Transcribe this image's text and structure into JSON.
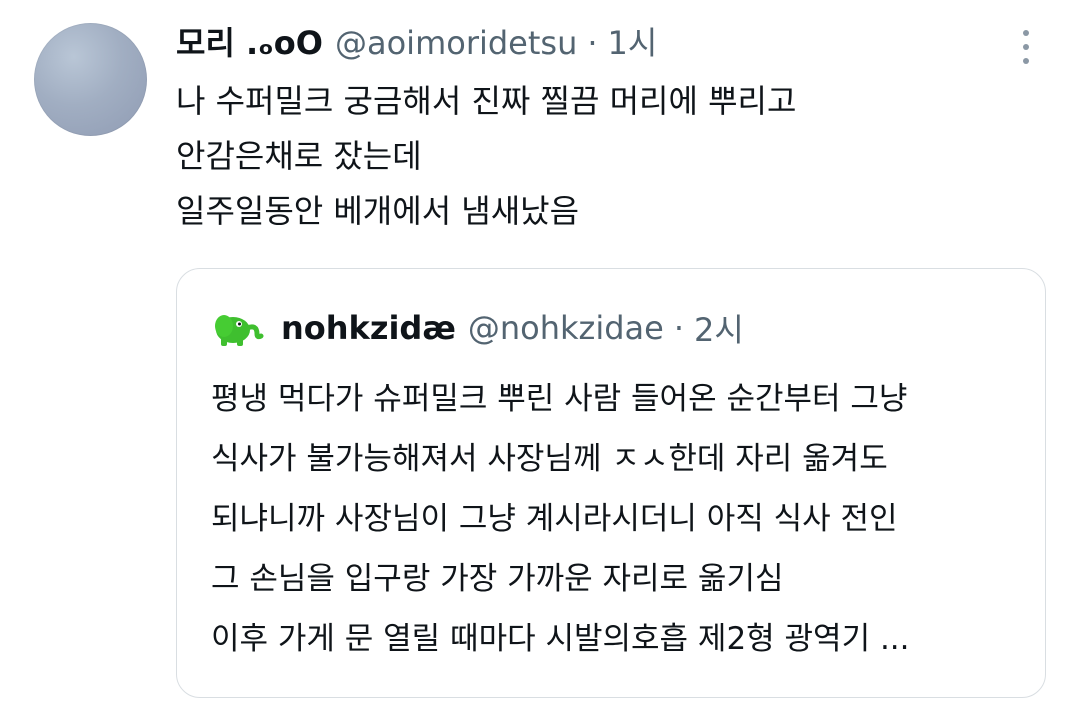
{
  "tweet": {
    "display_name": "모리 .ₒoO",
    "handle": "@aoimoridetsu",
    "separator": "·",
    "time": "1시",
    "lines": [
      "나 수퍼밀크 궁금해서 진짜 찔끔 머리에 뿌리고",
      "안감은채로 잤는데",
      "일주일동안 베개에서 냄새났음"
    ],
    "icons": {
      "more": "more-vertical-icon"
    }
  },
  "quote": {
    "display_name": "nohkzidæ",
    "handle": "@nohkzidae",
    "separator": "·",
    "time": "2시",
    "avatar_icon": "green-elephant-avatar",
    "lines": [
      "평냉 먹다가 슈퍼밀크 뿌린 사람 들어온 순간부터 그냥",
      "식사가 불가능해져서 사장님께 ㅈㅅ한데 자리 옮겨도",
      "되냐니까 사장님이 그냥 계시라시더니 아직 식사 전인",
      "그 손님을 입구랑 가장 가까운 자리로 옮기심",
      "이후 가게 문 열릴 때마다 시발의호흡 제2형 광역기 ..."
    ]
  },
  "colors": {
    "text": "#0f1419",
    "secondary": "#536471",
    "border": "#d9dee2",
    "avatar_green": "#3fbf2f"
  }
}
